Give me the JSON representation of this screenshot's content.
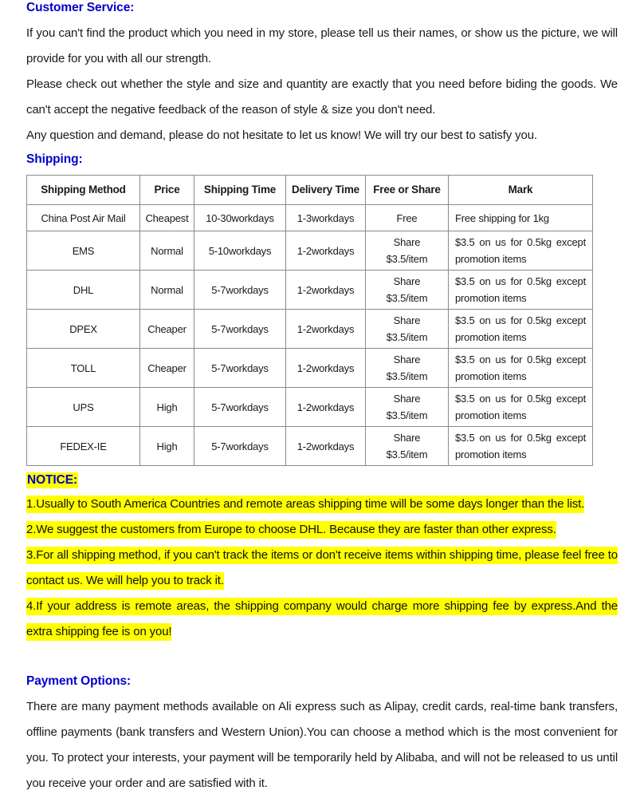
{
  "customer_service": {
    "heading": "Customer Service:",
    "paragraphs": [
      "If you can't find the product which you need in my store, please tell us their names, or show us the picture, we will provide for you with all our strength.",
      "Please check out whether the style and size and quantity are exactly that you need before biding the goods. We can't accept the negative feedback of the reason of style & size you don't need.",
      "Any question and demand, please do not hesitate to let us know! We will try our best to satisfy you."
    ]
  },
  "shipping": {
    "heading": "Shipping:",
    "table": {
      "columns": [
        "Shipping Method",
        "Price",
        "Shipping Time",
        "Delivery Time",
        "Free or Share",
        "Mark"
      ],
      "rows": [
        {
          "method": "China Post Air Mail",
          "price": "Cheapest",
          "shipping_time": "10-30workdays",
          "delivery_time": "1-3workdays",
          "free_or_share_line1": "Free",
          "free_or_share_line2": "",
          "mark": "Free shipping for 1kg"
        },
        {
          "method": "EMS",
          "price": "Normal",
          "shipping_time": "5-10workdays",
          "delivery_time": "1-2workdays",
          "free_or_share_line1": "Share",
          "free_or_share_line2": "$3.5/item",
          "mark": "$3.5 on us for 0.5kg except promotion items"
        },
        {
          "method": "DHL",
          "price": "Normal",
          "shipping_time": "5-7workdays",
          "delivery_time": "1-2workdays",
          "free_or_share_line1": "Share",
          "free_or_share_line2": "$3.5/item",
          "mark": "$3.5 on us for 0.5kg except promotion items"
        },
        {
          "method": "DPEX",
          "price": "Cheaper",
          "shipping_time": "5-7workdays",
          "delivery_time": "1-2workdays",
          "free_or_share_line1": "Share",
          "free_or_share_line2": "$3.5/item",
          "mark": "$3.5 on us for 0.5kg except promotion items"
        },
        {
          "method": "TOLL",
          "price": "Cheaper",
          "shipping_time": "5-7workdays",
          "delivery_time": "1-2workdays",
          "free_or_share_line1": "Share",
          "free_or_share_line2": "$3.5/item",
          "mark": "$3.5 on us for 0.5kg except promotion items"
        },
        {
          "method": "UPS",
          "price": "High",
          "shipping_time": "5-7workdays",
          "delivery_time": "1-2workdays",
          "free_or_share_line1": "Share",
          "free_or_share_line2": "$3.5/item",
          "mark": "$3.5 on us for 0.5kg except promotion items"
        },
        {
          "method": "FEDEX-IE",
          "price": "High",
          "shipping_time": "5-7workdays",
          "delivery_time": "1-2workdays",
          "free_or_share_line1": "Share",
          "free_or_share_line2": "$3.5/item",
          "mark": "$3.5 on us for 0.5kg except promotion items"
        }
      ]
    }
  },
  "notice": {
    "heading": "NOTICE:",
    "items": [
      "1.Usually to South America Countries and remote areas shipping time will be some days longer than the list.",
      "2.We suggest the customers from Europe to choose DHL. Because they are faster than other express.",
      "3.For all shipping method, if you can't track the items or don't receive items within shipping time, please feel free to contact us. We will help you to track it.",
      "4.If your address is remote areas, the shipping company would charge more shipping fee by express.And the extra shipping fee is on you!"
    ]
  },
  "payment": {
    "heading": "Payment Options:",
    "paragraph": "There are many payment methods available on Ali express such as Alipay, credit cards, real-time bank transfers, offline payments (bank transfers and Western Union).You can choose a method which is the most convenient for you. To protect your interests, your payment will be temporarily held by Alibaba, and will not be released to us until you receive your order and are satisfied with it."
  },
  "colors": {
    "heading_blue": "#0000CC",
    "highlight_yellow": "#FFFF00",
    "body_text": "#1a1a1a",
    "table_border": "#8a8a8a"
  }
}
